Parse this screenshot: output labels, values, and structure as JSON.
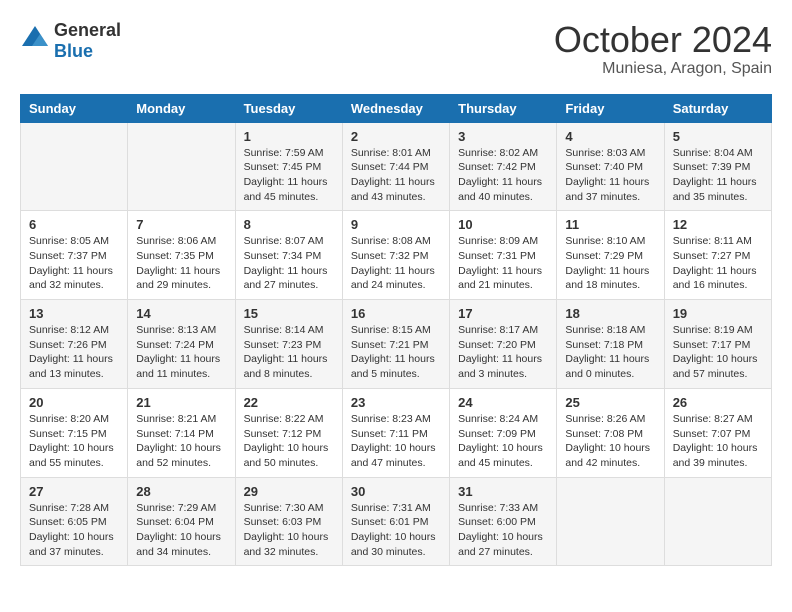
{
  "logo": {
    "general": "General",
    "blue": "Blue"
  },
  "title": "October 2024",
  "location": "Muniesa, Aragon, Spain",
  "headers": [
    "Sunday",
    "Monday",
    "Tuesday",
    "Wednesday",
    "Thursday",
    "Friday",
    "Saturday"
  ],
  "weeks": [
    [
      {
        "day": "",
        "info": ""
      },
      {
        "day": "",
        "info": ""
      },
      {
        "day": "1",
        "info": "Sunrise: 7:59 AM\nSunset: 7:45 PM\nDaylight: 11 hours and 45 minutes."
      },
      {
        "day": "2",
        "info": "Sunrise: 8:01 AM\nSunset: 7:44 PM\nDaylight: 11 hours and 43 minutes."
      },
      {
        "day": "3",
        "info": "Sunrise: 8:02 AM\nSunset: 7:42 PM\nDaylight: 11 hours and 40 minutes."
      },
      {
        "day": "4",
        "info": "Sunrise: 8:03 AM\nSunset: 7:40 PM\nDaylight: 11 hours and 37 minutes."
      },
      {
        "day": "5",
        "info": "Sunrise: 8:04 AM\nSunset: 7:39 PM\nDaylight: 11 hours and 35 minutes."
      }
    ],
    [
      {
        "day": "6",
        "info": "Sunrise: 8:05 AM\nSunset: 7:37 PM\nDaylight: 11 hours and 32 minutes."
      },
      {
        "day": "7",
        "info": "Sunrise: 8:06 AM\nSunset: 7:35 PM\nDaylight: 11 hours and 29 minutes."
      },
      {
        "day": "8",
        "info": "Sunrise: 8:07 AM\nSunset: 7:34 PM\nDaylight: 11 hours and 27 minutes."
      },
      {
        "day": "9",
        "info": "Sunrise: 8:08 AM\nSunset: 7:32 PM\nDaylight: 11 hours and 24 minutes."
      },
      {
        "day": "10",
        "info": "Sunrise: 8:09 AM\nSunset: 7:31 PM\nDaylight: 11 hours and 21 minutes."
      },
      {
        "day": "11",
        "info": "Sunrise: 8:10 AM\nSunset: 7:29 PM\nDaylight: 11 hours and 18 minutes."
      },
      {
        "day": "12",
        "info": "Sunrise: 8:11 AM\nSunset: 7:27 PM\nDaylight: 11 hours and 16 minutes."
      }
    ],
    [
      {
        "day": "13",
        "info": "Sunrise: 8:12 AM\nSunset: 7:26 PM\nDaylight: 11 hours and 13 minutes."
      },
      {
        "day": "14",
        "info": "Sunrise: 8:13 AM\nSunset: 7:24 PM\nDaylight: 11 hours and 11 minutes."
      },
      {
        "day": "15",
        "info": "Sunrise: 8:14 AM\nSunset: 7:23 PM\nDaylight: 11 hours and 8 minutes."
      },
      {
        "day": "16",
        "info": "Sunrise: 8:15 AM\nSunset: 7:21 PM\nDaylight: 11 hours and 5 minutes."
      },
      {
        "day": "17",
        "info": "Sunrise: 8:17 AM\nSunset: 7:20 PM\nDaylight: 11 hours and 3 minutes."
      },
      {
        "day": "18",
        "info": "Sunrise: 8:18 AM\nSunset: 7:18 PM\nDaylight: 11 hours and 0 minutes."
      },
      {
        "day": "19",
        "info": "Sunrise: 8:19 AM\nSunset: 7:17 PM\nDaylight: 10 hours and 57 minutes."
      }
    ],
    [
      {
        "day": "20",
        "info": "Sunrise: 8:20 AM\nSunset: 7:15 PM\nDaylight: 10 hours and 55 minutes."
      },
      {
        "day": "21",
        "info": "Sunrise: 8:21 AM\nSunset: 7:14 PM\nDaylight: 10 hours and 52 minutes."
      },
      {
        "day": "22",
        "info": "Sunrise: 8:22 AM\nSunset: 7:12 PM\nDaylight: 10 hours and 50 minutes."
      },
      {
        "day": "23",
        "info": "Sunrise: 8:23 AM\nSunset: 7:11 PM\nDaylight: 10 hours and 47 minutes."
      },
      {
        "day": "24",
        "info": "Sunrise: 8:24 AM\nSunset: 7:09 PM\nDaylight: 10 hours and 45 minutes."
      },
      {
        "day": "25",
        "info": "Sunrise: 8:26 AM\nSunset: 7:08 PM\nDaylight: 10 hours and 42 minutes."
      },
      {
        "day": "26",
        "info": "Sunrise: 8:27 AM\nSunset: 7:07 PM\nDaylight: 10 hours and 39 minutes."
      }
    ],
    [
      {
        "day": "27",
        "info": "Sunrise: 7:28 AM\nSunset: 6:05 PM\nDaylight: 10 hours and 37 minutes."
      },
      {
        "day": "28",
        "info": "Sunrise: 7:29 AM\nSunset: 6:04 PM\nDaylight: 10 hours and 34 minutes."
      },
      {
        "day": "29",
        "info": "Sunrise: 7:30 AM\nSunset: 6:03 PM\nDaylight: 10 hours and 32 minutes."
      },
      {
        "day": "30",
        "info": "Sunrise: 7:31 AM\nSunset: 6:01 PM\nDaylight: 10 hours and 30 minutes."
      },
      {
        "day": "31",
        "info": "Sunrise: 7:33 AM\nSunset: 6:00 PM\nDaylight: 10 hours and 27 minutes."
      },
      {
        "day": "",
        "info": ""
      },
      {
        "day": "",
        "info": ""
      }
    ]
  ]
}
